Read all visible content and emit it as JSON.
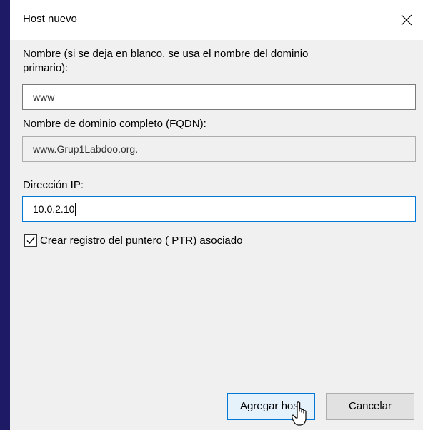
{
  "dialog": {
    "title": "Host nuevo",
    "close_icon": "close-icon",
    "name_label_line1": "Nombre (si se deja en blanco, se usa el nombre del dominio",
    "name_label_line2": "primario):",
    "name_value": "www",
    "fqdn_label": "Nombre de dominio completo (FQDN):",
    "fqdn_value": "www.Grup1Labdoo.org.",
    "ip_label": "Dirección IP:",
    "ip_value": "10.0.2.10",
    "ptr_checkbox_label": "Crear registro del puntero ( PTR) asociado",
    "ptr_checked": true,
    "add_button_label": "Agregar host",
    "cancel_button_label": "Cancelar"
  },
  "colors": {
    "background": "#1f1a66",
    "dialog": "#f0f0f0",
    "focus_border": "#0078d7"
  }
}
